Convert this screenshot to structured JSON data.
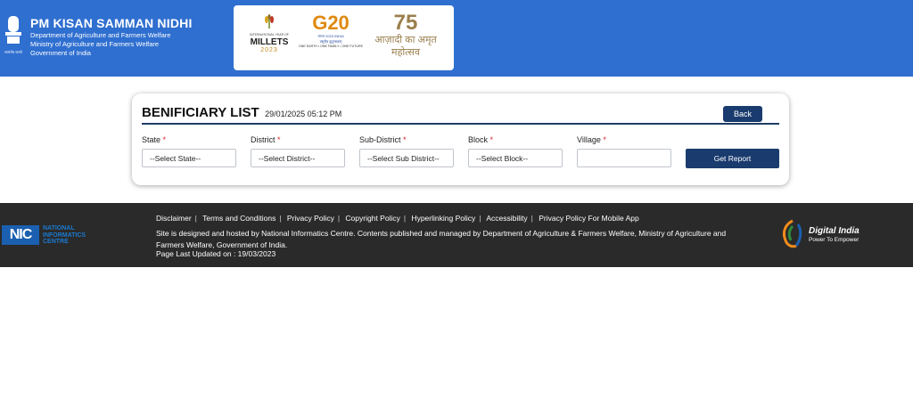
{
  "header": {
    "title": "PM KISAN SAMMAN NIDHI",
    "lines": [
      "Department of Agriculture and Farmers Welfare",
      "Ministry of Agriculture and Farmers Welfare",
      "Government of India"
    ],
    "emblem_caption": "सत्यमेव जयते",
    "logos": {
      "millets_small": "INTERNATIONAL YEAR OF",
      "millets_big": "MILLETS",
      "millets_year": "2023",
      "g20_mark": "G20",
      "g20_sub": "भारत 2023 INDIA",
      "g20_hindi": "वसुधैव कुटुम्बकम्",
      "g20_tagline": "ONE EARTH • ONE FAMILY • ONE FUTURE",
      "amrit_num": "75",
      "amrit_text": "आज़ादी का अमृत महोत्सव"
    }
  },
  "card": {
    "title": "BENIFICIARY LIST",
    "datetime": "29/01/2025 05:12 PM",
    "back_label": "Back",
    "report_label": "Get Report",
    "fields": [
      {
        "label": "State",
        "value": "--Select State--"
      },
      {
        "label": "District",
        "value": "--Select District--"
      },
      {
        "label": "Sub-District",
        "value": "--Select Sub District--"
      },
      {
        "label": "Block",
        "value": "--Select Block--"
      },
      {
        "label": "Village",
        "value": ""
      }
    ],
    "required_mark": "*"
  },
  "footer": {
    "links": [
      "Disclaimer",
      "Terms and Conditions",
      "Privacy Policy",
      "Copyright Policy",
      "Hyperlinking Policy",
      "Accessibility",
      "Privacy Policy For Mobile App"
    ],
    "hosted_text": "Site is designed and hosted by National Informatics Centre. Contents published and managed by Department of Agriculture & Farmers Welfare, Ministry of Agriculture and Farmers Welfare, Government of India.",
    "updated_text": "Page Last Updated on : 19/03/2023",
    "nic_mark": "NIC",
    "nic_name": [
      "NATIONAL",
      "INFORMATICS",
      "CENTRE"
    ],
    "di_title": "Digital India",
    "di_sub": "Power To Empower"
  },
  "colors": {
    "header_bg": "#2f6fd0",
    "button_bg": "#1a3b6e",
    "footer_bg": "#2a2a2a"
  }
}
